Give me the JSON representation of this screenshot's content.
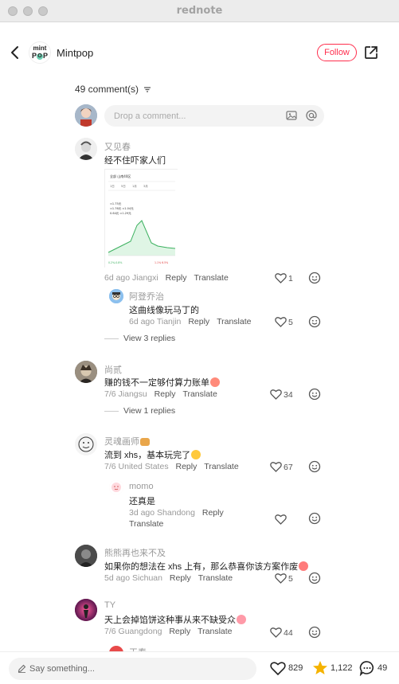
{
  "window": {
    "title": "rednote"
  },
  "header": {
    "account_name": "Mintpop",
    "logo_line1": "mint",
    "logo_line2a": "P",
    "logo_dot": "O",
    "logo_line2b": "P",
    "follow_label": "Follow"
  },
  "comments_header": {
    "count_label": "49 comment(s)"
  },
  "composer": {
    "placeholder": "Drop a comment..."
  },
  "comments": [
    {
      "name": "又见春",
      "text": "经不住吓家人们",
      "date": "6d ago",
      "location": "Jiangxi",
      "reply": "Reply",
      "translate": "Translate",
      "likes": "1",
      "image": {
        "mini_title": "全部 山南40区",
        "mini_tabs": [
          "1日",
          "5日",
          "1月",
          "3月"
        ],
        "mini_lines": [
          "≈1.75元",
          "≈1.76元 ≈1.04元",
          "0.64元 ≈1.29元"
        ],
        "mini_foot_left": "0.2%-0.8%",
        "mini_foot_right": "1.1% 6.5%"
      }
    },
    {
      "name": "阿登乔治",
      "text": "这曲线像玩马丁的",
      "date": "6d ago",
      "location": "Tianjin",
      "reply": "Reply",
      "translate": "Translate",
      "likes": "5"
    },
    {
      "view_more": "View 3 replies"
    },
    {
      "name": "尚贰",
      "text": "赚的钱不一定够付算力账单",
      "date": "7/6",
      "location": "Jiangsu",
      "reply": "Reply",
      "translate": "Translate",
      "likes": "34"
    },
    {
      "view_more": "View 1 replies"
    },
    {
      "name": "灵魂画师",
      "text": "流到 xhs，基本玩完了",
      "date": "7/6",
      "location": "United States",
      "reply": "Reply",
      "translate": "Translate",
      "likes": "67"
    },
    {
      "name": "momo",
      "text": "还真是",
      "date": "3d ago",
      "location": "Shandong",
      "reply": "Reply",
      "translate": "Translate",
      "likes": ""
    },
    {
      "name": "熊熊再也来不及",
      "text": "如果你的想法在 xhs 上有，那么恭喜你该方案作废",
      "date": "5d ago",
      "location": "Sichuan",
      "reply": "Reply",
      "translate": "Translate",
      "likes": "5"
    },
    {
      "name": "TY",
      "text": "天上会掉馅饼这种事从来不缺受众",
      "date": "7/6",
      "location": "Guangdong",
      "reply": "Reply",
      "translate": "Translate",
      "likes": "44"
    },
    {
      "name": "王春",
      "partial": true
    }
  ],
  "bottom": {
    "say_placeholder": "Say something...",
    "likes": "829",
    "collects": "1,122",
    "comments": "49"
  },
  "colors": {
    "accent": "#ff2e4d",
    "star": "#f5b301"
  }
}
